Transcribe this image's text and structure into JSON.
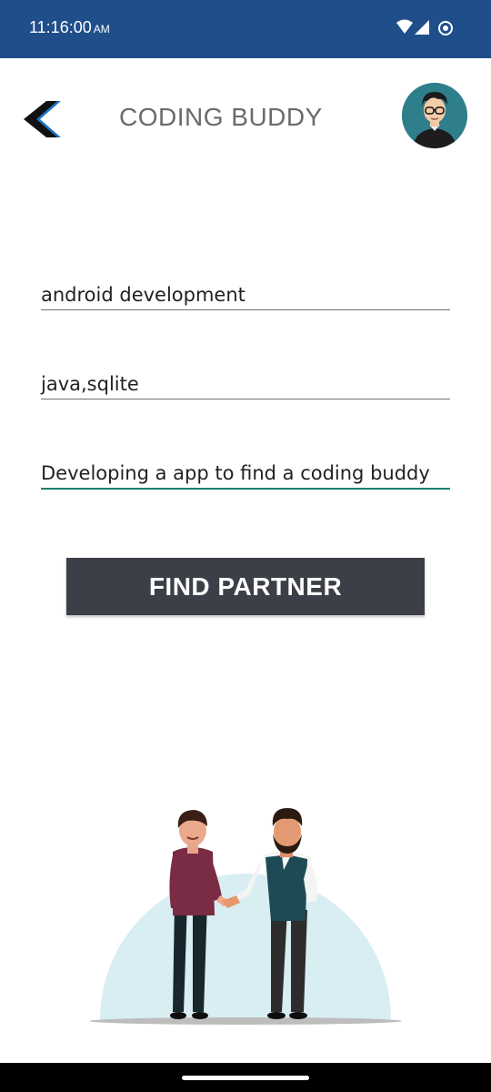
{
  "status_bar": {
    "time": "11:16:00",
    "ampm": "AM",
    "icons": [
      "wifi-icon",
      "signal-icon",
      "data-saver-icon"
    ]
  },
  "header": {
    "title": "CODING BUDDY",
    "back_icon": "chevron-left-icon",
    "avatar_icon": "user-avatar-icon"
  },
  "form": {
    "fields": [
      {
        "value": "android development"
      },
      {
        "value": "java,sqlite"
      },
      {
        "value": "Developing a app to find a coding buddy"
      }
    ],
    "submit_label": "FIND PARTNER"
  },
  "illustration": {
    "icon": "handshake-illustration"
  },
  "colors": {
    "status_bar": "#1f4e8a",
    "button": "#3c3f47",
    "active_underline": "#1a7f72",
    "avatar_bg": "#2f7e8c"
  }
}
